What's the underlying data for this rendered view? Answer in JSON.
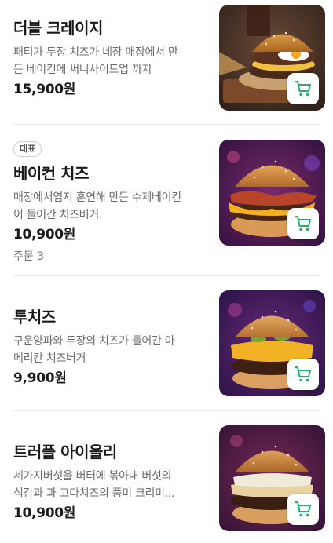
{
  "menu": {
    "items": [
      {
        "name": "더블 크레이지",
        "description_line1": "패티가 두장 치즈가 네장 매장에서 만",
        "description_line2": "든 베이컨에 써니사이드업 까지",
        "price": "15,900원"
      },
      {
        "badge": "대표",
        "name": "베이컨 치즈",
        "description_line1": "매장에서염지 훈연해 만든 수제베이컨",
        "description_line2": "이 들어간 치즈버거.",
        "price": "10,900원",
        "orders": "주문 3"
      },
      {
        "name": "투치즈",
        "description_line1": "구운양파와 두장의 치즈가 들어간 아",
        "description_line2": "메리칸 치즈버거",
        "price": "9,900원"
      },
      {
        "name": "트러플 아이올리",
        "description_line1": "세가지버섯을 버터에 볶아내 버섯의",
        "description_line2": "식감과 과 고다치즈의 풍미 크리미...",
        "price": "10,900원"
      }
    ],
    "cart_icon": "cart-icon",
    "accent_color": "#1fb26b"
  }
}
